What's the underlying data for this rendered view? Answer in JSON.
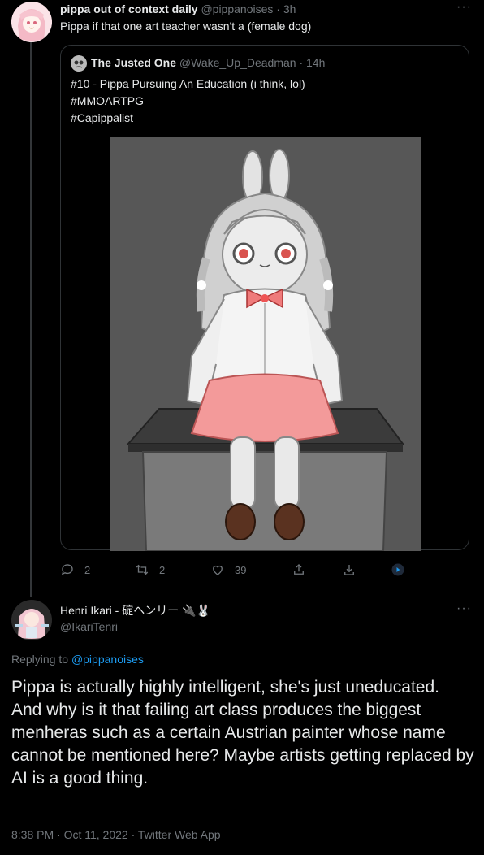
{
  "tweet1": {
    "name": "pippa out of context daily",
    "handle": "@pippanoises",
    "time": "· 3h",
    "text": "Pippa if that one art teacher wasn't a (female dog)",
    "actions": {
      "reply_count": "2",
      "retweet_count": "2",
      "like_count": "39"
    }
  },
  "quote": {
    "name": "The Justed One",
    "handle": "@Wake_Up_Deadman",
    "time": "· 14h",
    "line1": "#10 - Pippa Pursuing An Education (i think, lol)",
    "line2": "#MMOARTPG",
    "line3": "#Capippalist"
  },
  "tweet2": {
    "name": "Henri Ikari - 碇ヘンリー 🔌🐰",
    "handle": "@IkariTenri",
    "replying_prefix": "Replying to",
    "replying_handle": "@pippanoises",
    "para1": "Pippa is actually highly intelligent, she's just uneducated.",
    "para2": "And why is it that failing art class produces the biggest menheras such as a certain Austrian painter whose name cannot be mentioned here? Maybe artists getting replaced by AI is a good thing.",
    "timestamp": "8:38 PM · Oct 11, 2022 · Twitter Web App"
  },
  "icons": [
    "more-icon",
    "reply-icon",
    "retweet-icon",
    "like-icon",
    "share-icon",
    "download-icon",
    "promote-icon"
  ],
  "colors": {
    "background": "#000000",
    "text": "#e7e9ea",
    "muted": "#71767b",
    "link": "#1d9bf0",
    "border": "#2f3336"
  }
}
